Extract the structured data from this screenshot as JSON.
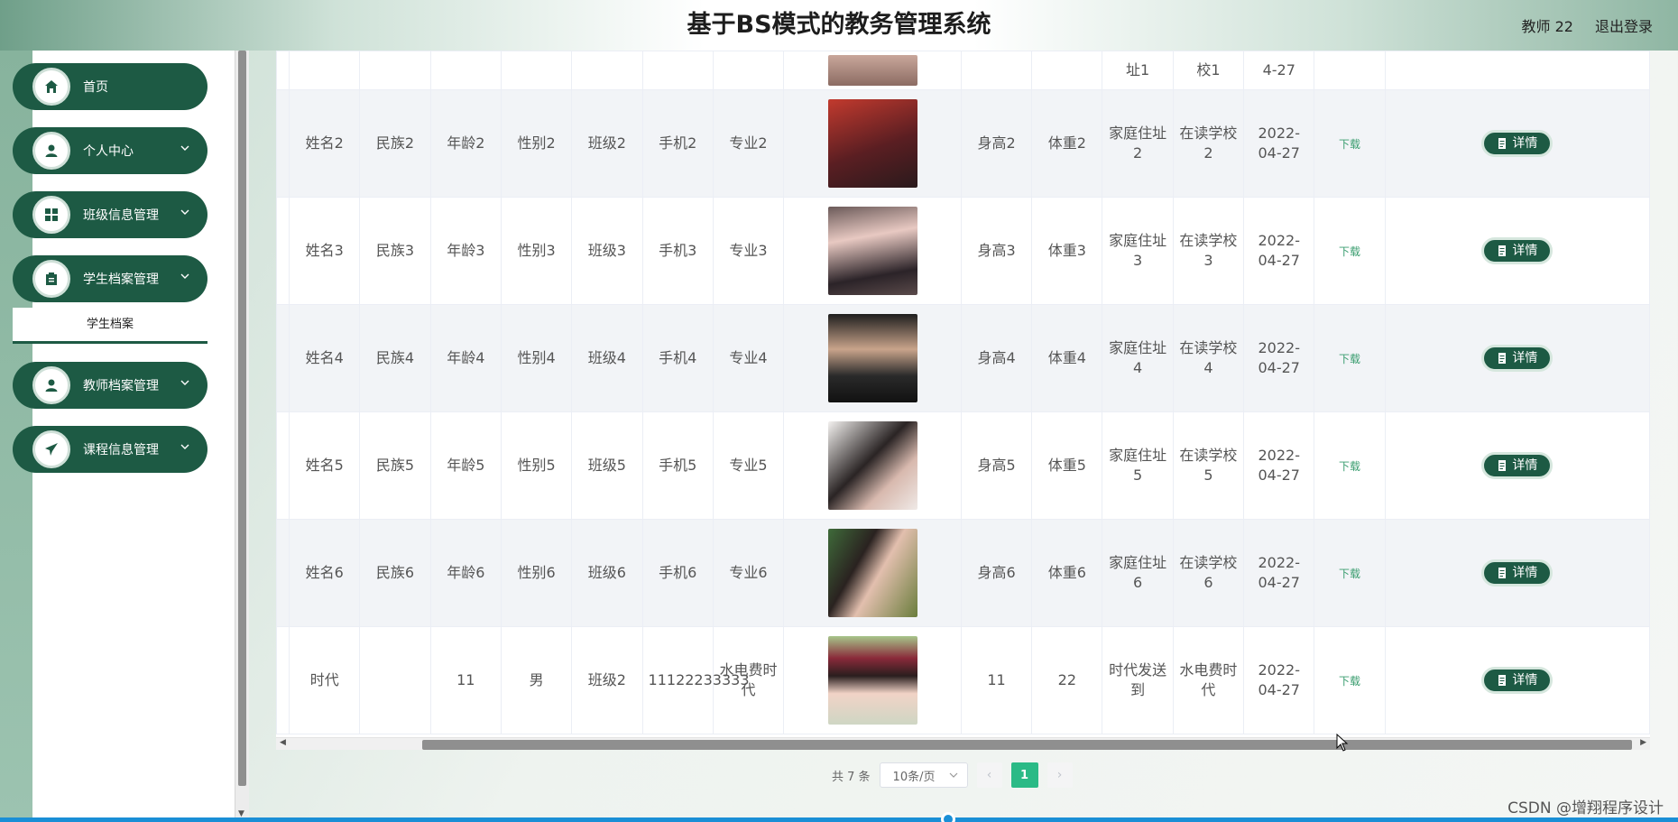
{
  "header": {
    "title": "基于BS模式的教务管理系统",
    "user": "教师 22",
    "logout": "退出登录"
  },
  "sidebar": {
    "items": [
      {
        "label": "首页",
        "icon": "home-icon"
      },
      {
        "label": "个人中心",
        "icon": "person-icon"
      },
      {
        "label": "班级信息管理",
        "icon": "grid-icon"
      },
      {
        "label": "学生档案管理",
        "icon": "clipboard-icon",
        "sub": "学生档案"
      },
      {
        "label": "教师档案管理",
        "icon": "person-icon"
      },
      {
        "label": "课程信息管理",
        "icon": "send-icon"
      }
    ]
  },
  "table": {
    "partial_row": [
      "址1",
      "校1",
      "4-27"
    ],
    "rows": [
      {
        "name": "姓名2",
        "ethnic": "民族2",
        "age": "年龄2",
        "gender": "性别2",
        "class": "班级2",
        "phone": "手机2",
        "major": "专业2",
        "height": "身高2",
        "weight": "体重2",
        "address": "家庭住址2",
        "school": "在读学校2",
        "date": "2022-04-27",
        "download": "下载",
        "detail": "详情"
      },
      {
        "name": "姓名3",
        "ethnic": "民族3",
        "age": "年龄3",
        "gender": "性别3",
        "class": "班级3",
        "phone": "手机3",
        "major": "专业3",
        "height": "身高3",
        "weight": "体重3",
        "address": "家庭住址3",
        "school": "在读学校3",
        "date": "2022-04-27",
        "download": "下载",
        "detail": "详情"
      },
      {
        "name": "姓名4",
        "ethnic": "民族4",
        "age": "年龄4",
        "gender": "性别4",
        "class": "班级4",
        "phone": "手机4",
        "major": "专业4",
        "height": "身高4",
        "weight": "体重4",
        "address": "家庭住址4",
        "school": "在读学校4",
        "date": "2022-04-27",
        "download": "下载",
        "detail": "详情"
      },
      {
        "name": "姓名5",
        "ethnic": "民族5",
        "age": "年龄5",
        "gender": "性别5",
        "class": "班级5",
        "phone": "手机5",
        "major": "专业5",
        "height": "身高5",
        "weight": "体重5",
        "address": "家庭住址5",
        "school": "在读学校5",
        "date": "2022-04-27",
        "download": "下载",
        "detail": "详情"
      },
      {
        "name": "姓名6",
        "ethnic": "民族6",
        "age": "年龄6",
        "gender": "性别6",
        "class": "班级6",
        "phone": "手机6",
        "major": "专业6",
        "height": "身高6",
        "weight": "体重6",
        "address": "家庭住址6",
        "school": "在读学校6",
        "date": "2022-04-27",
        "download": "下载",
        "detail": "详情"
      },
      {
        "name": "时代",
        "ethnic": "",
        "age": "11",
        "gender": "男",
        "class": "班级2",
        "phone": "11122233333",
        "major": "水电费时代",
        "height": "11",
        "weight": "22",
        "address": "时代发送到",
        "school": "水电费时代",
        "date": "2022-04-27",
        "download": "下载",
        "detail": "详情"
      }
    ]
  },
  "pagination": {
    "total": "共 7 条",
    "page_size": "10条/页",
    "current": "1",
    "prev": "‹",
    "next": "›"
  },
  "watermark": "CSDN @增翔程序设计",
  "colors": {
    "primary": "#1d5a44",
    "accent": "#2bba86"
  }
}
